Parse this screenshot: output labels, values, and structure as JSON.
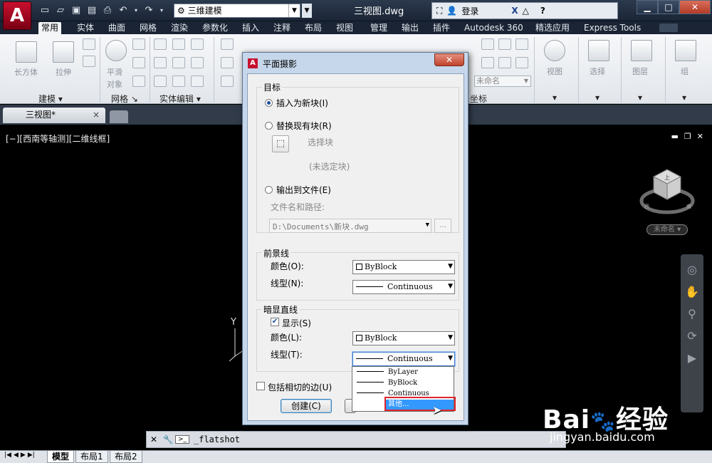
{
  "app": {
    "logo_letter": "A",
    "doc_title": "三视图.dwg",
    "workspace": "三维建模",
    "login": "登录",
    "qat_icons": [
      "new-icon",
      "open-icon",
      "save-icon",
      "save-as-icon",
      "print-icon",
      "undo-icon",
      "redo-icon",
      "gear-icon"
    ],
    "window_buttons": [
      "▭",
      "❐",
      "✕"
    ]
  },
  "ribbon_tabs": [
    {
      "label": "常用",
      "active": true
    },
    {
      "label": "实体"
    },
    {
      "label": "曲面"
    },
    {
      "label": "网格"
    },
    {
      "label": "渲染"
    },
    {
      "label": "参数化"
    },
    {
      "label": "插入"
    },
    {
      "label": "注释"
    },
    {
      "label": "布局"
    },
    {
      "label": "视图"
    },
    {
      "label": "管理"
    },
    {
      "label": "输出"
    },
    {
      "label": "插件"
    },
    {
      "label": "Autodesk 360"
    },
    {
      "label": "精选应用"
    },
    {
      "label": "Express Tools"
    }
  ],
  "ribbon": {
    "tools": {
      "box": "长方体",
      "extrude": "拉伸",
      "smooth": "平滑",
      "object": "对象",
      "unnamed": "未命名",
      "view": "视图",
      "select": "选择",
      "layer": "图层",
      "group": "组"
    },
    "panels": {
      "modeling": "建模",
      "mesh": "网格",
      "solid_edit": "实体编辑",
      "coords": "坐标"
    }
  },
  "file_tabs": {
    "active": "三视图*",
    "close": "×"
  },
  "viewport": {
    "label": "[−][西南等轴测][二维线框]",
    "viewcube_name": "未命名",
    "viewcube_faces": {
      "top": "上",
      "left": "西",
      "right": "南"
    },
    "ucs_axis": "Y"
  },
  "command_line": {
    "prompt": "_flatshot"
  },
  "layout_tabs": [
    {
      "label": "模型",
      "active": true
    },
    {
      "label": "布局1"
    },
    {
      "label": "布局2"
    }
  ],
  "dialog": {
    "title": "平面摄影",
    "close": "✕",
    "target": {
      "title": "目标",
      "insert_new_block": "插入为新块(I)",
      "replace_block": "替换现有块(R)",
      "select_block": "选择块",
      "no_block": "(未选定块)",
      "export_file": "输出到文件(E)",
      "file_label": "文件名和路径:",
      "file_value": "D:\\Documents\\新块.dwg",
      "browse": "..."
    },
    "foreground": {
      "title": "前景线",
      "color_label": "颜色(O):",
      "color_value": "ByBlock",
      "linetype_label": "线型(N):",
      "linetype_value": "Continuous"
    },
    "obscured": {
      "title": "暗显直线",
      "show_label": "显示(S)",
      "color_label": "颜色(L):",
      "color_value": "ByBlock",
      "linetype_label": "线型(T):",
      "linetype_value": "Continuous",
      "dropdown_options": [
        "ByLayer",
        "ByBlock",
        "Continuous",
        "其他..."
      ],
      "highlighted": "其他..."
    },
    "tangent_edges": "包括相切的边(U)",
    "create_button": "创建(C)"
  },
  "watermark": {
    "brand_a": "Bai",
    "brand_b": "经验",
    "url": "jingyan.baidu.com"
  }
}
